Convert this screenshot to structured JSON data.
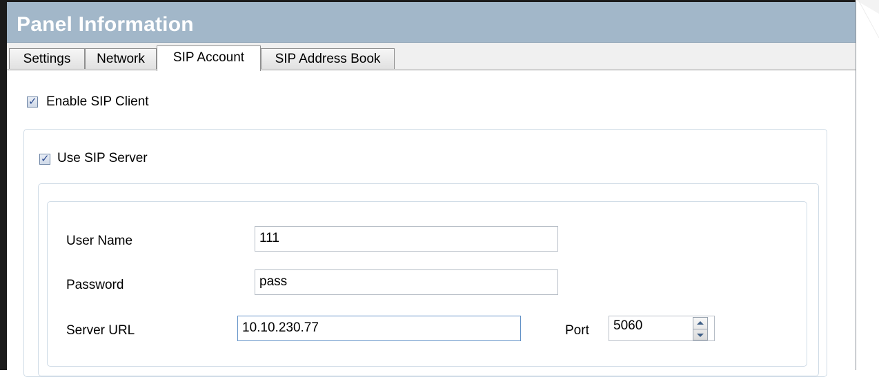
{
  "header": {
    "title": "Panel Information"
  },
  "tabs": [
    {
      "label": "Settings"
    },
    {
      "label": "Network"
    },
    {
      "label": "SIP Account"
    },
    {
      "label": "SIP Address Book"
    }
  ],
  "active_tab": "SIP Account",
  "enable_sip_client": {
    "label": "Enable SIP Client",
    "checked": true
  },
  "use_sip_server": {
    "label": "Use SIP Server",
    "checked": true
  },
  "account": {
    "user_name_label": "User Name",
    "user_name_value": "111",
    "password_label": "Password",
    "password_value": "pass",
    "server_url_label": "Server URL",
    "server_url_value": "10.10.230.77",
    "port_label": "Port",
    "port_value": "5060"
  },
  "colors": {
    "header_bg": "#a2b7c9",
    "header_text": "#ffffff",
    "checkbox_check": "#2b4a8f",
    "focus_border": "#5f8fc6"
  }
}
